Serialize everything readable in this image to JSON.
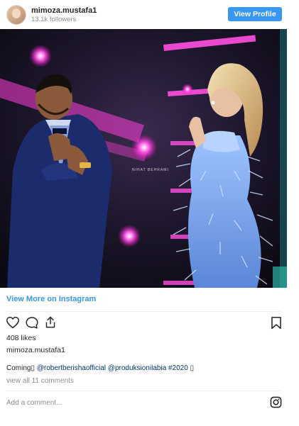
{
  "header": {
    "username": "mimoza.mustafa1",
    "followers": "13.1k followers",
    "view_profile": "View Profile"
  },
  "photo": {
    "watermark": "NIHAT BEHRAMI"
  },
  "view_more": "View More on Instagram",
  "likes": "408 likes",
  "owner": "mimoza.mustafa1",
  "caption": {
    "text": "Coming",
    "glyph1": "▯",
    "mention1": "@robertberishaofficial",
    "mention2": "@produksionilabia",
    "hashtag": "#2020",
    "glyph2": "▯"
  },
  "view_comments": "view all 11 comments",
  "add_comment_placeholder": "Add a comment...",
  "colors": {
    "accent": "#3897f0",
    "link": "#003569",
    "muted": "#8e8e8e"
  }
}
